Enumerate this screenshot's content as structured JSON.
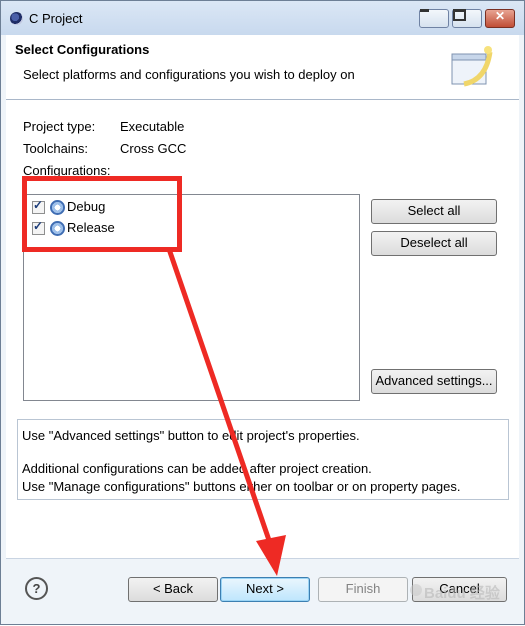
{
  "window": {
    "title": "C Project"
  },
  "header": {
    "title": "Select Configurations",
    "description": "Select platforms and configurations you wish to deploy on"
  },
  "project": {
    "type_label": "Project type:",
    "type_value": "Executable",
    "toolchains_label": "Toolchains:",
    "toolchains_value": "Cross GCC",
    "configurations_label": "Configurations:"
  },
  "configurations": [
    {
      "label": "Debug",
      "checked": true
    },
    {
      "label": "Release",
      "checked": true
    }
  ],
  "side_buttons": {
    "select_all": "Select all",
    "deselect_all": "Deselect all",
    "advanced": "Advanced settings..."
  },
  "message": {
    "line1": "Use \"Advanced settings\" button to edit project's properties.",
    "line2": "Additional configurations can be added after project creation.",
    "line3": "Use \"Manage configurations\" buttons either on toolbar or on property pages."
  },
  "footer": {
    "help": "?",
    "back": "< Back",
    "next": "Next >",
    "finish": "Finish",
    "cancel": "Cancel"
  },
  "annotation_color": "#ee2a24",
  "watermark_text": "Baidu 经验"
}
